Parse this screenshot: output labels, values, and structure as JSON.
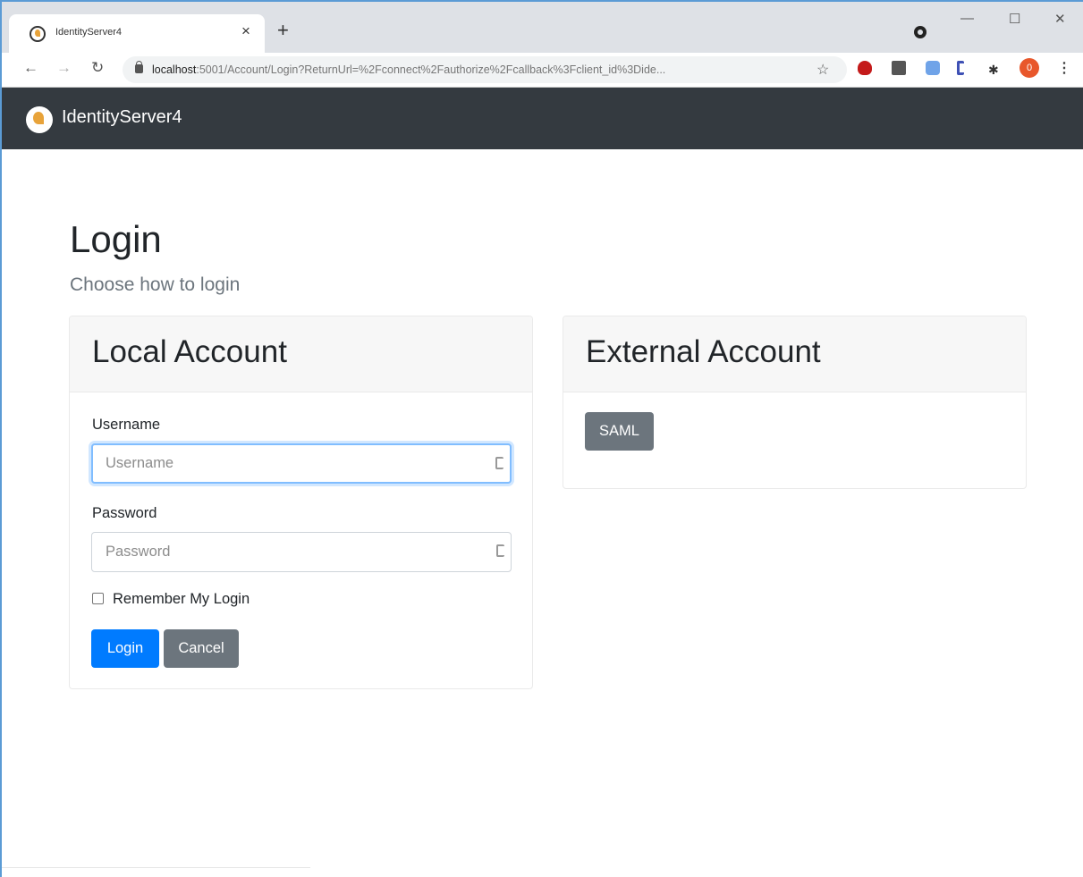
{
  "browser": {
    "tab_title": "IdentityServer4",
    "tab_close": "×",
    "new_tab": "+",
    "url_host": "localhost",
    "url_rest": ":5001/Account/Login?ReturnUrl=%2Fconnect%2Fauthorize%2Fcallback%3Fclient_id%3Dide...",
    "profile_badge": "0",
    "icons": [
      "back-icon",
      "forward-icon",
      "reload-icon",
      "lock-icon",
      "star-icon",
      "extensions-icon",
      "menu-icon"
    ]
  },
  "navbar": {
    "brand": "IdentityServer4"
  },
  "page": {
    "title": "Login",
    "subtitle": "Choose how to login"
  },
  "local_account": {
    "header": "Local Account",
    "username_label": "Username",
    "username_placeholder": "Username",
    "password_label": "Password",
    "password_placeholder": "Password",
    "remember_label": "Remember My Login",
    "login_button": "Login",
    "cancel_button": "Cancel"
  },
  "external_account": {
    "header": "External Account",
    "saml_button": "SAML"
  },
  "colors": {
    "navbar_bg": "#343a40",
    "primary": "#007bff",
    "secondary": "#6c757d",
    "focus_border": "#80bdff"
  }
}
